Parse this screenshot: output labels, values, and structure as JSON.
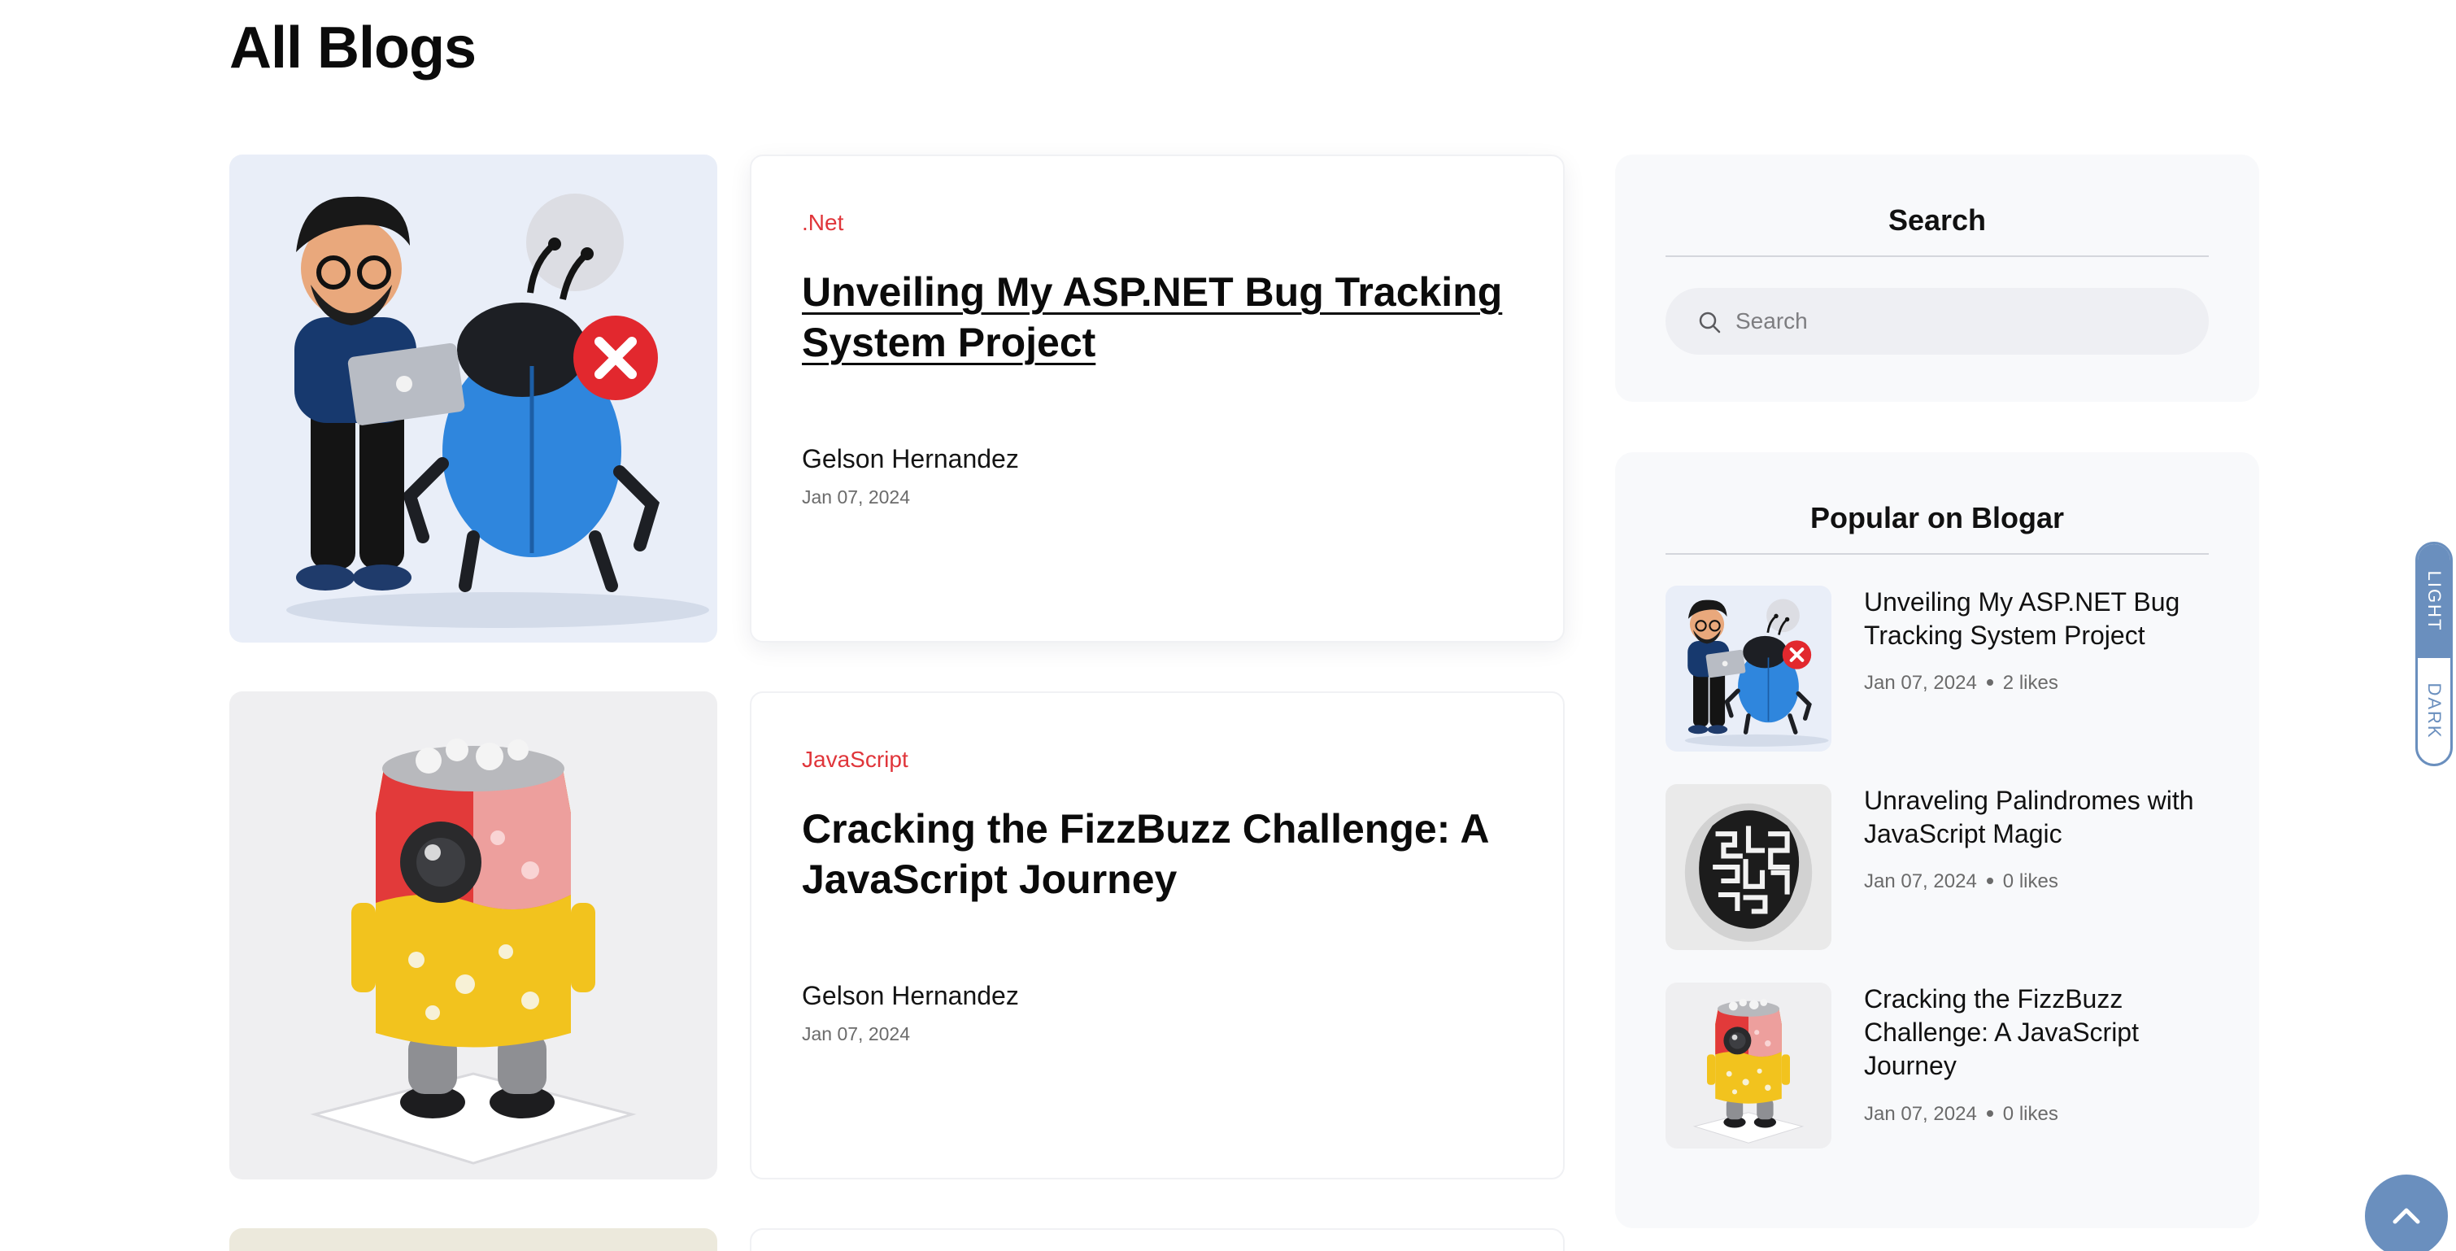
{
  "page": {
    "title": "All Blogs"
  },
  "posts": [
    {
      "category": ".Net",
      "title": "Unveiling My ASP.NET Bug Tracking System Project",
      "author": "Gelson Hernandez",
      "date": "Jan 07, 2024",
      "image": "bug-tracking-illustration"
    },
    {
      "category": "JavaScript",
      "title": "Cracking the FizzBuzz Challenge: A JavaScript Journey",
      "author": "Gelson Hernandez",
      "date": "Jan 07, 2024",
      "image": "soda-can-robot-illustration"
    }
  ],
  "sidebar": {
    "search": {
      "heading": "Search",
      "placeholder": "Search"
    },
    "popular": {
      "heading": "Popular on Blogar",
      "items": [
        {
          "title": "Unveiling My ASP.NET Bug Tracking System Project",
          "date": "Jan 07, 2024",
          "likes": "2 likes",
          "image": "bug-tracking-illustration"
        },
        {
          "title": "Unraveling Palindromes with JavaScript Magic",
          "date": "Jan 07, 2024",
          "likes": "0 likes",
          "image": "palindrome-head-illustration"
        },
        {
          "title": "Cracking the FizzBuzz Challenge: A JavaScript Journey",
          "date": "Jan 07, 2024",
          "likes": "0 likes",
          "image": "soda-can-robot-illustration"
        }
      ]
    }
  },
  "theme_toggle": {
    "light_label": "LIGHT",
    "dark_label": "DARK",
    "active": "light"
  },
  "colors": {
    "accent": "#6a8fbe",
    "category": "#e0353a",
    "sidebar_bg": "#f8f9fb"
  }
}
